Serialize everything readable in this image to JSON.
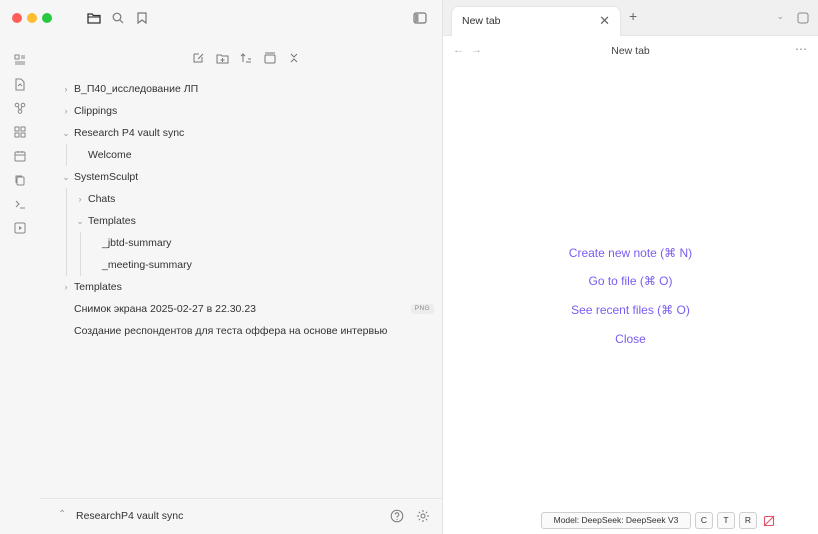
{
  "explorer": {
    "items": [
      {
        "label": "В_П40_исследование ЛП",
        "kind": "folder",
        "expanded": false,
        "depth": 0
      },
      {
        "label": "Clippings",
        "kind": "folder",
        "expanded": false,
        "depth": 0
      },
      {
        "label": "Research P4 vault sync",
        "kind": "folder",
        "expanded": true,
        "depth": 0
      },
      {
        "label": "Welcome",
        "kind": "file",
        "depth": 1
      },
      {
        "label": "SystemSculpt",
        "kind": "folder",
        "expanded": true,
        "depth": 0
      },
      {
        "label": "Chats",
        "kind": "folder",
        "expanded": false,
        "depth": 1
      },
      {
        "label": "Templates",
        "kind": "folder",
        "expanded": true,
        "depth": 1
      },
      {
        "label": "_jbtd-summary",
        "kind": "file",
        "depth": 2
      },
      {
        "label": "_meeting-summary",
        "kind": "file",
        "depth": 2
      },
      {
        "label": "Templates",
        "kind": "folder",
        "expanded": false,
        "depth": 0
      },
      {
        "label": "Снимок экрана 2025-02-27 в 22.30.23",
        "kind": "file",
        "depth": 0,
        "badge": "PNG"
      },
      {
        "label": "Создание респондентов для теста оффера на основе интервью",
        "kind": "file",
        "depth": 0
      }
    ]
  },
  "vault": {
    "name": "ResearchP4 vault sync"
  },
  "tabs": [
    {
      "title": "New tab"
    }
  ],
  "view": {
    "title": "New tab"
  },
  "empty_state": {
    "create": "Create new note (⌘ N)",
    "goto": "Go to file (⌘ O)",
    "recent": "See recent files (⌘ O)",
    "close": "Close"
  },
  "statusbar": {
    "model": "Model: DeepSeek: DeepSeek V3",
    "c": "C",
    "t": "T",
    "r": "R"
  },
  "colors": {
    "accent": "#7b5cf0",
    "red": "#ff5f57",
    "yellow": "#febc2e",
    "green": "#28c840"
  }
}
